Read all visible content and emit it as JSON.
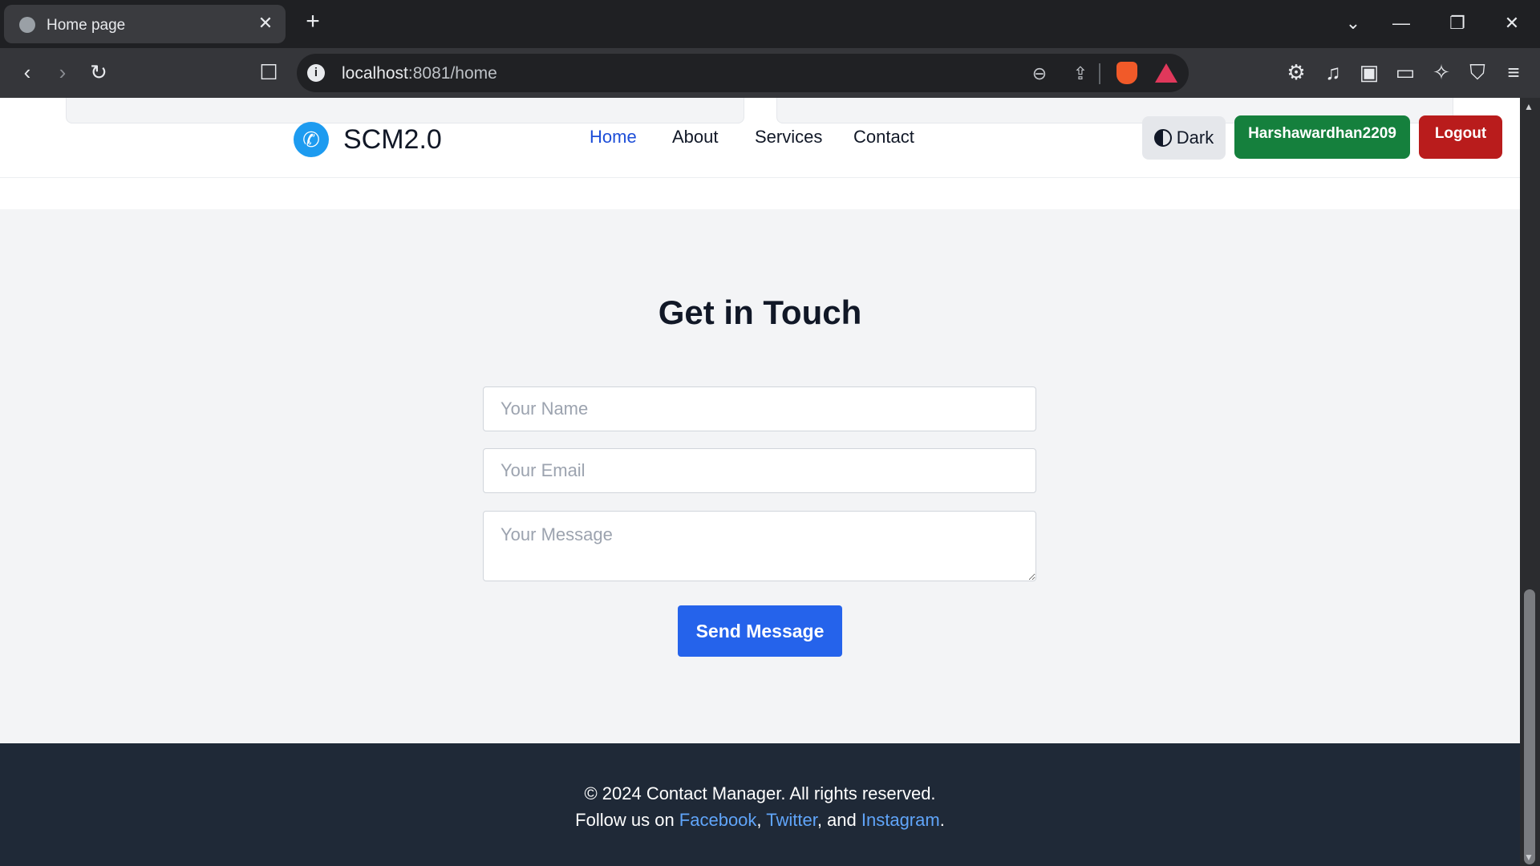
{
  "browser": {
    "tab_title": "Home page",
    "url_host": "localhost",
    "url_rest": ":8081/home"
  },
  "navbar": {
    "brand": "SCM2.0",
    "links": [
      {
        "label": "Home",
        "active": true
      },
      {
        "label": "About",
        "active": false
      },
      {
        "label": "Services",
        "active": false
      },
      {
        "label": "Contact",
        "active": false
      }
    ],
    "theme_button": "Dark",
    "user_button": "Harshawardhan2209",
    "logout_button": "Logout"
  },
  "contact": {
    "title": "Get in Touch",
    "name_placeholder": "Your Name",
    "email_placeholder": "Your Email",
    "message_placeholder": "Your Message",
    "submit_label": "Send Message"
  },
  "footer": {
    "copyright": "© 2024 Contact Manager. All rights reserved.",
    "follow_prefix": "Follow us on ",
    "links": [
      "Facebook",
      "Twitter",
      "Instagram"
    ],
    "sep_comma": ", ",
    "sep_and": ", and ",
    "suffix": "."
  },
  "colors": {
    "accent": "#2563eb",
    "user_button": "#15803d",
    "logout_button": "#b91c1c",
    "footer_bg": "#1f2937"
  }
}
